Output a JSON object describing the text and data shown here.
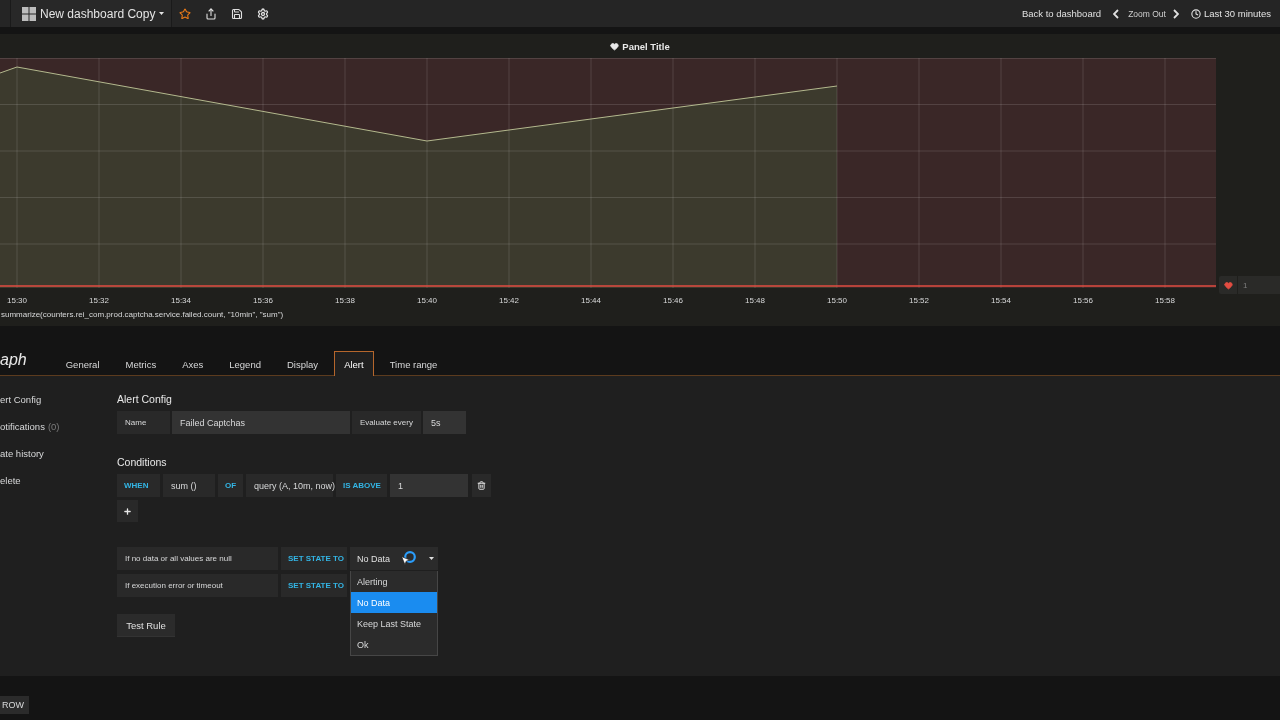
{
  "navbar": {
    "dashboard_title": "New dashboard Copy",
    "back_link": "Back to dashboard",
    "zoom_out": "Zoom Out",
    "time_range": "Last 30 minutes"
  },
  "panel": {
    "title": "Panel Title",
    "time_labels": [
      "15:30",
      "15:32",
      "15:34",
      "15:36",
      "15:38",
      "15:40",
      "15:42",
      "15:44",
      "15:46",
      "15:48",
      "15:50",
      "15:52",
      "15:54",
      "15:56",
      "15:58"
    ],
    "threshold_value": "1",
    "query": "summarize(counters.rei_com.prod.captcha.service.failed.count, \"10min\", \"sum\")"
  },
  "editor": {
    "title": "aph",
    "tabs": [
      {
        "label": "General",
        "selected": false
      },
      {
        "label": "Metrics",
        "selected": false
      },
      {
        "label": "Axes",
        "selected": false
      },
      {
        "label": "Legend",
        "selected": false
      },
      {
        "label": "Display",
        "selected": false
      },
      {
        "label": "Alert",
        "selected": true
      },
      {
        "label": "Time range",
        "selected": false
      }
    ],
    "sidebar": [
      {
        "label": "ert Config"
      },
      {
        "label": "otifications",
        "count": "(0)"
      },
      {
        "label": "ate history"
      },
      {
        "label": "elete"
      }
    ],
    "alert_config": {
      "heading": "Alert Config",
      "fields": [
        {
          "kind": "label",
          "text": "Name"
        },
        {
          "kind": "input",
          "text": "Failed Captchas"
        },
        {
          "kind": "label",
          "text": "Evaluate every"
        },
        {
          "kind": "input",
          "text": "5s"
        }
      ]
    },
    "conditions": {
      "heading": "Conditions",
      "parts": [
        {
          "kind": "keyword",
          "text": "WHEN"
        },
        {
          "kind": "value",
          "text": "sum ()"
        },
        {
          "kind": "keyword",
          "text": "OF"
        },
        {
          "kind": "value",
          "text": "query (A, 10m, now)"
        },
        {
          "kind": "keyword",
          "text": "IS ABOVE"
        },
        {
          "kind": "input",
          "text": "1"
        }
      ]
    },
    "state_rules": [
      {
        "label": "If no data or all values are null",
        "action": "SET STATE TO",
        "value": "No Data",
        "open": true,
        "options": [
          {
            "label": "Alerting",
            "selected": false
          },
          {
            "label": "No Data",
            "selected": true
          },
          {
            "label": "Keep Last State",
            "selected": false
          },
          {
            "label": "Ok",
            "selected": false
          }
        ]
      },
      {
        "label": "If execution error or timeout",
        "action": "SET STATE TO"
      }
    ],
    "test_button": "Test Rule"
  },
  "footer": {
    "row_button": "ROW"
  }
}
